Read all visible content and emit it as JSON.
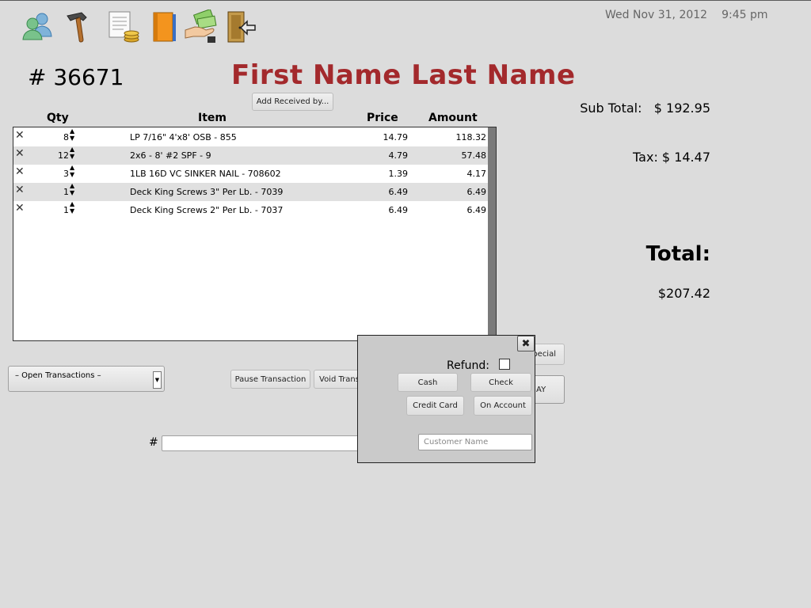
{
  "header": {
    "date": "Wed Nov 31, 2012",
    "time": "9:45 pm",
    "order_number": "# 36671",
    "customer_name": "First Name Last Name"
  },
  "toolbar": {
    "icons": [
      "customers-icon",
      "hammer-icon",
      "ledger-coins-icon",
      "book-icon",
      "payment-hand-icon",
      "exit-door-icon"
    ]
  },
  "buttons": {
    "add_received_by": "Add Received by...",
    "pause_transaction": "Pause Transaction",
    "void_transaction": "Void Trans",
    "special": "pecial",
    "pay": "AY"
  },
  "table": {
    "columns": {
      "qty": "Qty",
      "item": "Item",
      "price": "Price",
      "amount": "Amount"
    },
    "rows": [
      {
        "qty": "8",
        "item": "LP 7/16\" 4'x8' OSB - 855",
        "price": "14.79",
        "amount": "118.32"
      },
      {
        "qty": "12",
        "item": "2x6 - 8' #2 SPF - 9",
        "price": "4.79",
        "amount": "57.48"
      },
      {
        "qty": "3",
        "item": "1LB 16D VC SINKER NAIL - 708602",
        "price": "1.39",
        "amount": "4.17"
      },
      {
        "qty": "1",
        "item": "Deck King Screws 3\" Per Lb. - 7039",
        "price": "6.49",
        "amount": "6.49"
      },
      {
        "qty": "1",
        "item": "Deck King Screws 2\" Per Lb. - 7037",
        "price": "6.49",
        "amount": "6.49"
      }
    ]
  },
  "summary": {
    "subtotal_label": "Sub Total:",
    "subtotal_value": "$ 192.95",
    "tax_text": "Tax: $ 14.47",
    "total_label": "Total:",
    "total_value": "$207.42"
  },
  "transactions": {
    "dropdown_label": "– Open Transactions –",
    "number_label": "#"
  },
  "dialog": {
    "refund_label": "Refund:",
    "cash": "Cash",
    "check": "Check",
    "credit_card": "Credit Card",
    "on_account": "On Account",
    "customer_placeholder": "Customer Name"
  },
  "colors": {
    "customer_name": "#a3292c",
    "background": "#dcdcdc"
  }
}
